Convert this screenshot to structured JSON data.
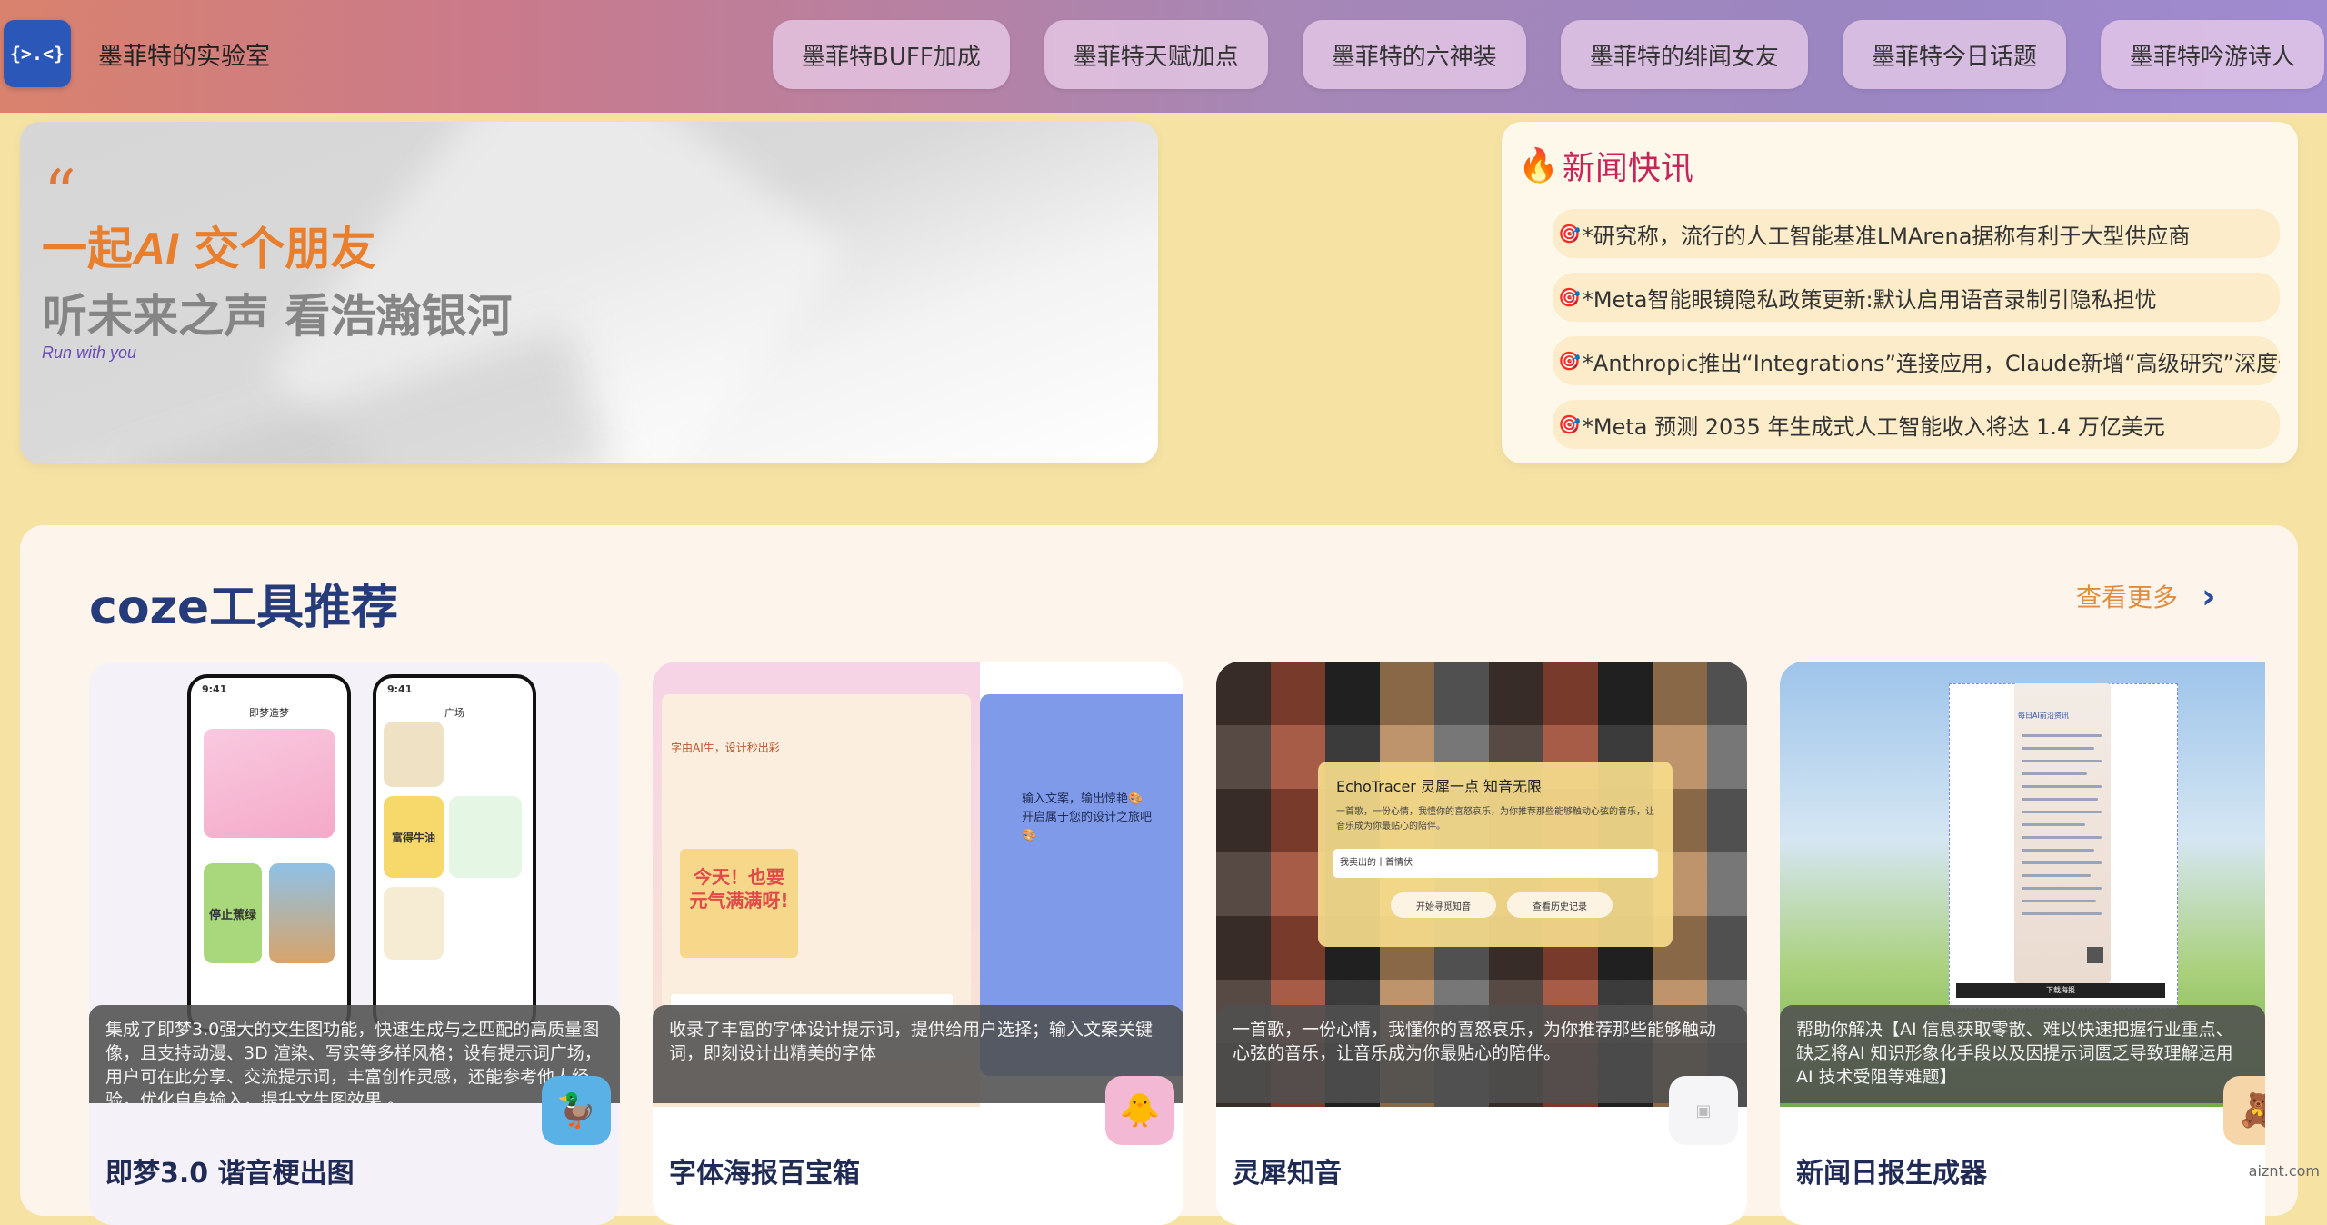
{
  "header": {
    "logo_text": "{>.<}",
    "site_title": "墨菲特的实验室",
    "nav": [
      "墨菲特BUFF加成",
      "墨菲特天赋加点",
      "墨菲特的六神装",
      "墨菲特的绯闻女友",
      "墨菲特今日话题",
      "墨菲特吟游诗人"
    ]
  },
  "hero": {
    "quote": "“",
    "line1_a": "一起",
    "line1_ai": "AI",
    "line1_b": " 交个朋友",
    "line2": "听未来之声 看浩瀚银河",
    "line3": "Run with you"
  },
  "news": {
    "title": "新闻快讯",
    "icon": "fire-icon",
    "items": [
      "*研究称，流行的人工智能基准LMArena据称有利于大型供应商",
      "*Meta智能眼镜隐私政策更新:默认启用语音录制引隐私担忧",
      "*Anthropic推出“Integrations”连接应用，Claude新增“高级研究”深度信息",
      "*Meta 预测 2035 年生成式人工智能收入将达 1.4 万亿美元"
    ]
  },
  "tools": {
    "title": "coze工具推荐",
    "see_more": "查看更多",
    "cards": [
      {
        "title": "即梦3.0 谐音梗出图",
        "desc": "集成了即梦3.0强大的文生图功能，快速生成与之匹配的高质量图像，且支持动漫、3D 渲染、写实等多样风格；设有提示词广场，用户可在此分享、交流提示词，丰富创作灵感，还能参考他人经验，优化自身输入，提升文生图效果 。",
        "phone1_time": "9:41",
        "phone1_title": "即梦造梦",
        "phone2_time": "9:41",
        "phone2_title": "广场",
        "sticker1": "停止蕉绿",
        "sticker2": "富得牛油"
      },
      {
        "title": "字体海报百宝箱",
        "desc": "收录了丰富的字体设计提示词，提供给用户选择；输入文案关键词，即刻设计出精美的字体",
        "panel_heading": "字由AI生，设计秒出彩",
        "poster_text": "今天！也要元气满满呀!",
        "right_text": "输入文案，输出惊艳🎨 开启属于您的设计之旅吧🎨"
      },
      {
        "title": "灵犀知音",
        "desc": "一首歌，一份心情，我懂你的喜怒哀乐，为你推荐那些能够触动心弦的音乐，让音乐成为你最贴心的陪伴。",
        "panel_title": "EchoTracer 灵犀一点 知音无限",
        "panel_desc": "一首歌，一份心情，我懂你的喜怒哀乐，为你推荐那些能够触动心弦的音乐，让音乐成为你最贴心的陪伴。",
        "input_value": "我卖出的十首情伏",
        "btn1": "开始寻觅知音",
        "btn2": "查看历史记录"
      },
      {
        "title": "新闻日报生成器",
        "desc": "帮助你解决【AI 信息获取零散、难以快速把握行业重点、缺乏将AI 知识形象化手段以及因提示词匮乏导致理解运用 AI 技术受阻等难题】",
        "doc_heading": "每日AI前沿资讯",
        "doc_footer": "下载海报"
      }
    ]
  },
  "watermark": "aiznt.com",
  "colors": {
    "accent_orange": "#e97e2d",
    "news_red": "#c7255a",
    "tools_title": "#263c7a"
  }
}
